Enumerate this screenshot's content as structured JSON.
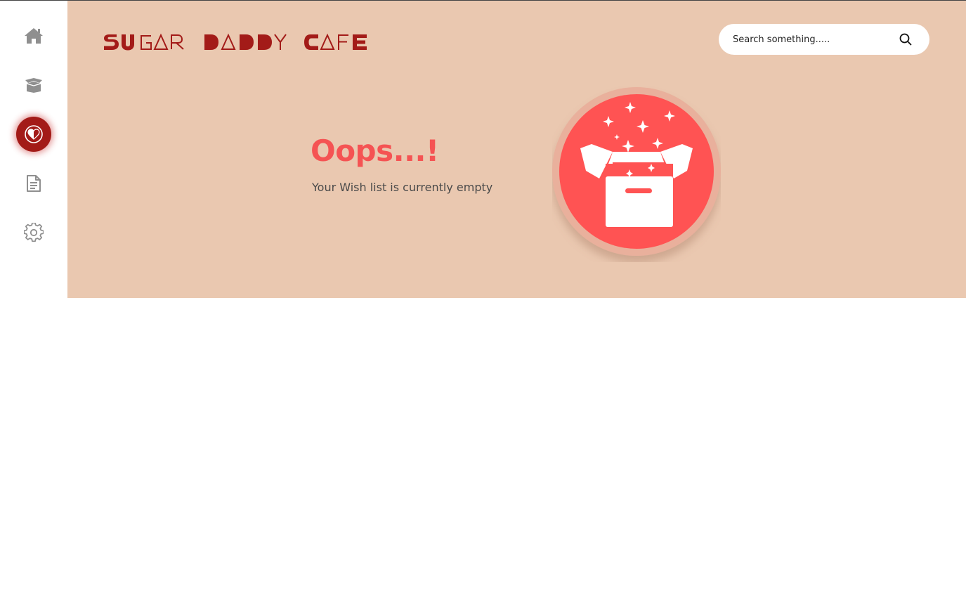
{
  "app": {
    "brand_name": "SUGAR DADDY CAFE"
  },
  "sidebar": {
    "items": [
      {
        "name": "home",
        "icon": "home-icon",
        "active": false
      },
      {
        "name": "products",
        "icon": "open-box-icon",
        "active": false
      },
      {
        "name": "wishlist",
        "icon": "heart-icon",
        "active": true
      },
      {
        "name": "orders",
        "icon": "document-icon",
        "active": false
      },
      {
        "name": "settings",
        "icon": "gear-icon",
        "active": false
      }
    ]
  },
  "search": {
    "placeholder": "Search something.....",
    "value": "",
    "icon": "search-icon"
  },
  "empty_state": {
    "title": "Oops...!",
    "message": "Your Wish list is currently empty",
    "illustration": "open-box-stars-icon"
  },
  "colors": {
    "hero_background": "#eac8b0",
    "brand": "#a31b18",
    "accent": "#f55353",
    "icon_gray": "#8f8f8f"
  }
}
